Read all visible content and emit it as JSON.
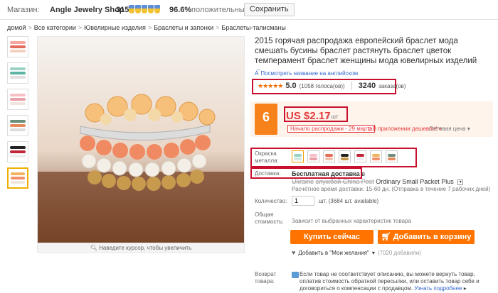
{
  "store": {
    "label": "Магазин:",
    "name": "Angle Jewelry Shop",
    "score": "315",
    "positive_pct": "96.6%",
    "feedback_label": "положительных отзывов",
    "save_button": "Сохранить"
  },
  "breadcrumb": [
    "домой",
    "Все категории",
    "Ювелирные изделия",
    "Браслеты и запонки",
    "Браслеты-талисманы"
  ],
  "breadcrumb_sep": ">",
  "gallery": {
    "hint": "Наведите курсор, чтобы увеличить",
    "thumb_count": 6,
    "selected_thumb": 6
  },
  "product": {
    "title": "2015 горячая распродажа европейский браслет мода смешать бусины браслет растянуть браслет цветок темперамент браслет женщины мода ювелирных изделий",
    "translate_link": "Посмотреть название на английском",
    "stars": "★★★★★",
    "rating": "5.0",
    "votes": "(1058 голоса(ов))",
    "orders_count": "3240",
    "orders_label": "заказа(ов)",
    "promo_badge": "6",
    "price": "US $2.17",
    "price_unit": "/ шт",
    "sale_start": "Начало распродажи - 29 марта",
    "app_deal": "В приложении дешевле!",
    "wholesale": "Оптовая цена",
    "color_label": "Окраска металла:",
    "shipping_label": "Доставка:",
    "shipping_free": "Бесплатная доставка",
    "shipping_to": "в",
    "shipping_country": "Ukraine",
    "shipping_method_strike": "службой China Post",
    "shipping_method": "Ordinary Small Packet Plus",
    "shipping_note": "Расчётное время доставки: 15-60 дн. (Отправка в течение 7 рабочих дней)",
    "qty_label": "Количество:",
    "qty_value": "1",
    "qty_available": "шт. (3684 шт. available)",
    "total_label": "Общая стоимость:",
    "total_note": "Зависит от выбранных характеристик товара",
    "buy_now": "Купить сейчас",
    "add_cart": "Добавить в корзину",
    "wishlist": "Добавить в \"Мои желания\"",
    "wishlist_count": "(7020 добавили)",
    "return_label": "Возврат товара:",
    "return_text": "Если товар не соответствует описанию, вы можете вернуть товар, оплатив стоимость обратной пересылки, или оставить товар себе и договориться о компенсации с продавцом.",
    "return_more": "Узнать подробнее"
  },
  "colors": {
    "price_red": "#e4393c",
    "accent_orange": "#ff7400",
    "highlight_box": "#c8102e",
    "promo_orange": "#f7821b"
  }
}
